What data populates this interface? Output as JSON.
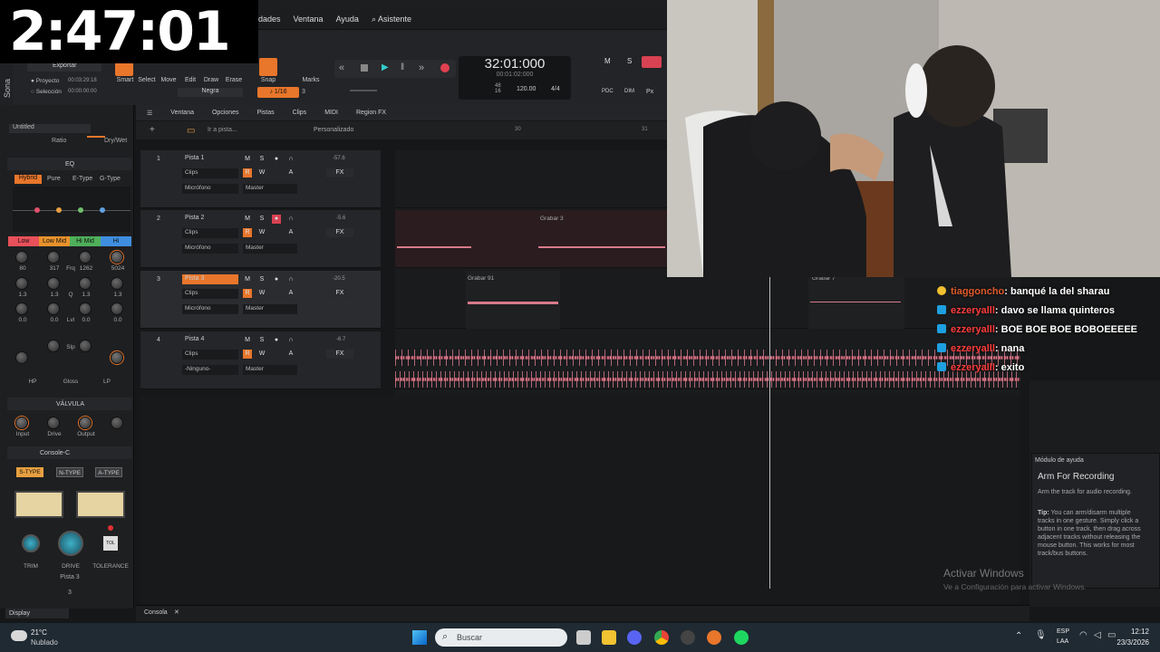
{
  "stream": {
    "timer": "2:47:01"
  },
  "menu": [
    "dades",
    "Ventana",
    "Ayuda",
    "Asistente"
  ],
  "app_name": "Sona",
  "toolbar": {
    "export_label": "Exportar",
    "proyecto_label": "Proyecto",
    "proyecto_time": "00:03:29:18",
    "seleccion_label": "Selección",
    "seleccion_time": "00:00:00:00",
    "tools": [
      "Smart",
      "Select",
      "Move",
      "Edit",
      "Draw",
      "Erase"
    ],
    "snap_label": "Snap",
    "marks_label": "Marks",
    "negra": "Negra",
    "snap_value": "1/16",
    "snap_num": "3",
    "big_time": "32:01:000",
    "small_time": "00:01:02:000",
    "tempo": "120.00",
    "meter": "4/4",
    "bits": "48",
    "bits2": "16",
    "msx": [
      "M",
      "S",
      "PDC",
      "DIM",
      "Px"
    ]
  },
  "toolbar2": [
    "Ventana",
    "Opciones",
    "Pistas",
    "Clips",
    "MIDI",
    "Region FX"
  ],
  "trackhead": {
    "search": "Ir a pista...",
    "preset": "Personalizado",
    "ruler": [
      "30",
      "31"
    ]
  },
  "left": {
    "untitled": "Untitled",
    "ratio": "Ratio",
    "drywet": "Dry/Wet",
    "eq_title": "EQ",
    "eq_modes": [
      "Hybrid",
      "Pure",
      "E-Type",
      "G-Type"
    ],
    "bands": [
      "Low",
      "Low Mid",
      "Hi Mid",
      "Hi"
    ],
    "freqs": [
      "80",
      "317",
      "1262",
      "5024"
    ],
    "frq_label": "Frq",
    "q_vals": [
      "1.3",
      "1.3",
      "1.3",
      "1.3"
    ],
    "q_label": "Q",
    "lvl_vals": [
      "0.0",
      "0.0",
      "0.0",
      "0.0"
    ],
    "lvl_label": "Lvl",
    "slp_label": "Slp",
    "filters": [
      "HP",
      "Gloss",
      "LP"
    ],
    "valve_title": "VÁLVULA",
    "valve_knobs": [
      "Input",
      "Drive",
      "Output"
    ],
    "console_title": "Console-C",
    "types": [
      "S-TYPE",
      "N-TYPE",
      "A-TYPE"
    ],
    "console_knobs": [
      "TRIM",
      "DRIVE",
      "TOLERANCE"
    ],
    "tol": "TOL",
    "pista": "Pista 3",
    "pista_num": "3",
    "display": "Display"
  },
  "tracks": [
    {
      "num": "1",
      "name": "Pista 1",
      "clips": "Clips",
      "input": "Micrófono",
      "out": "Master",
      "level": "-57.6"
    },
    {
      "num": "2",
      "name": "Pista 2",
      "clips": "Clips",
      "input": "Micrófono",
      "out": "Master",
      "level": "-5.6"
    },
    {
      "num": "3",
      "name": "Pista 3",
      "clips": "Clips",
      "input": "Micrófono",
      "out": "Master",
      "level": "-20.5"
    },
    {
      "num": "4",
      "name": "Pista 4",
      "clips": "Clips",
      "input": "-Ninguno-",
      "out": "Master",
      "level": "-6.7"
    }
  ],
  "track_btns": {
    "m": "M",
    "s": "S",
    "r": "R",
    "w": "W",
    "a": "A",
    "fx": "FX"
  },
  "clip_labels": [
    "Grabar 3",
    "Grabar 91",
    "Grabar 7"
  ],
  "console_tab": "Consola",
  "chat": [
    {
      "user": "tiaggoncho",
      "msg": ": banqué la del sharau"
    },
    {
      "user": "ezzeryalll",
      "msg": ": davo se llama quinteros"
    },
    {
      "user": "ezzeryalll",
      "msg": ": BOE BOE BOE BOBOEEEEE"
    },
    {
      "user": "ezzeryalll",
      "msg": ": nana"
    },
    {
      "user": "ezzeryalll",
      "msg": ": exito"
    }
  ],
  "help": {
    "header": "Módulo de ayuda",
    "title": "Arm For Recording",
    "body": "Arm the track for audio recording.",
    "tip_label": "Tip:",
    "tip": "You can arm/disarm multiple tracks in one gesture. Simply click a button in one track, then drag across adjacent tracks without releasing the mouse button. This works for most track/bus buttons."
  },
  "activation": {
    "title": "Activar Windows",
    "sub": "Ve a Configuración para activar Windows."
  },
  "taskbar": {
    "temp": "21°C",
    "weather": "Nublado",
    "search": "Buscar",
    "lang": "ESP",
    "lang2": "LAA",
    "time": "12:12",
    "date": "23/3/2026"
  }
}
